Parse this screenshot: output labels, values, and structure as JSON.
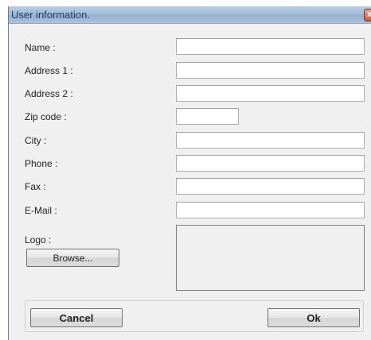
{
  "window": {
    "title": "User information.",
    "close_glyph": "x"
  },
  "form": {
    "name_label": "Name :",
    "address1_label": "Address 1 :",
    "address2_label": "Address 2 :",
    "zip_label": "Zip code :",
    "city_label": "City :",
    "phone_label": "Phone :",
    "fax_label": "Fax :",
    "email_label": "E-Mail :",
    "logo_label": "Logo :",
    "name_value": "",
    "address1_value": "",
    "address2_value": "",
    "zip_value": "",
    "city_value": "",
    "phone_value": "",
    "fax_value": "",
    "email_value": ""
  },
  "buttons": {
    "browse": "Browse...",
    "cancel": "Cancel",
    "ok": "Ok"
  }
}
